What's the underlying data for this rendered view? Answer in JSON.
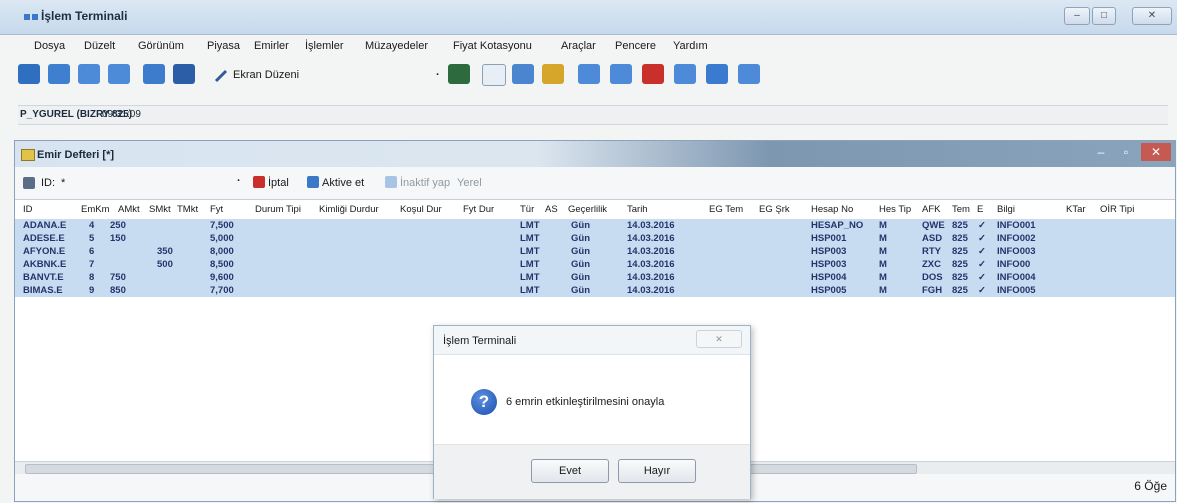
{
  "app": {
    "title": "İşlem Terminali"
  },
  "menu": [
    "Dosya",
    "Düzelt",
    "Görünüm",
    "Piyasa",
    "Emirler",
    "İşlemler",
    "Müzayedeler",
    "Fiyat Kotasyonu",
    "Araçlar",
    "Pencere",
    "Yardım"
  ],
  "toolbar": {
    "screen_layout_label": "Ekran Düzeni"
  },
  "status": {
    "user": "P_YGUREL (BIZRY 825)",
    "time": "09:31:09"
  },
  "child": {
    "title": "Emir Defteri [*]",
    "filter": {
      "id_label": "ID:",
      "id_value": "*",
      "cancel_label": "İptal",
      "activate_label": "Aktive et",
      "deactivate_label": "İnaktif yap",
      "local_label": "Yerel"
    },
    "columns": [
      "ID",
      "EmKm",
      "AMkt",
      "SMkt",
      "TMkt",
      "Fyt",
      "Durum Tipi",
      "Kimliği Durdur",
      "Koşul Dur",
      "Fyt Dur",
      "Tür",
      "AS",
      "Geçerlilik",
      "Tarih",
      "EG Tem",
      "EG Şrk",
      "Hesap No",
      "Hes Tip",
      "AFK",
      "Tem",
      "E",
      "Bilgi",
      "KTar",
      "OİR Tipi"
    ],
    "rows": [
      {
        "id": "ADANA.E",
        "emkm": "4",
        "amkt": "250",
        "smkt": "",
        "fyt": "7,500",
        "tur": "LMT",
        "gecerlilik": "Gün",
        "tarih": "14.03.2016",
        "hesap": "HESAP_NO",
        "hestip": "M",
        "afk": "QWE",
        "tem": "825",
        "e": "✓",
        "bilgi": "INFO001"
      },
      {
        "id": "ADESE.E",
        "emkm": "5",
        "amkt": "150",
        "smkt": "",
        "fyt": "5,000",
        "tur": "LMT",
        "gecerlilik": "Gün",
        "tarih": "14.03.2016",
        "hesap": "HSP001",
        "hestip": "M",
        "afk": "ASD",
        "tem": "825",
        "e": "✓",
        "bilgi": "INFO002"
      },
      {
        "id": "AFYON.E",
        "emkm": "6",
        "amkt": "",
        "smkt": "350",
        "fyt": "8,000",
        "tur": "LMT",
        "gecerlilik": "Gün",
        "tarih": "14.03.2016",
        "hesap": "HSP003",
        "hestip": "M",
        "afk": "RTY",
        "tem": "825",
        "e": "✓",
        "bilgi": "INFO003"
      },
      {
        "id": "AKBNK.E",
        "emkm": "7",
        "amkt": "",
        "smkt": "500",
        "fyt": "8,500",
        "tur": "LMT",
        "gecerlilik": "Gün",
        "tarih": "14.03.2016",
        "hesap": "HSP003",
        "hestip": "M",
        "afk": "ZXC",
        "tem": "825",
        "e": "✓",
        "bilgi": "INFO00"
      },
      {
        "id": "BANVT.E",
        "emkm": "8",
        "amkt": "750",
        "smkt": "",
        "fyt": "9,600",
        "tur": "LMT",
        "gecerlilik": "Gün",
        "tarih": "14.03.2016",
        "hesap": "HSP004",
        "hestip": "M",
        "afk": "DOS",
        "tem": "825",
        "e": "✓",
        "bilgi": "INFO004"
      },
      {
        "id": "BIMAS.E",
        "emkm": "9",
        "amkt": "850",
        "smkt": "",
        "fyt": "7,700",
        "tur": "LMT",
        "gecerlilik": "Gün",
        "tarih": "14.03.2016",
        "hesap": "HSP005",
        "hestip": "M",
        "afk": "FGH",
        "tem": "825",
        "e": "✓",
        "bilgi": "INFO005"
      }
    ],
    "item_count": "6 Öğe"
  },
  "dialog": {
    "title": "İşlem Terminali",
    "message": "6 emrin etkinleştirilmesini onayla",
    "yes_label": "Evet",
    "no_label": "Hayır"
  },
  "colors": {
    "selection": "#c8dcf1",
    "accent": "#1b4fae"
  }
}
